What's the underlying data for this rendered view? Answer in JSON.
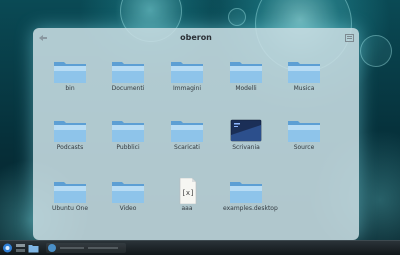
{
  "window": {
    "title": "oberon"
  },
  "items": [
    {
      "label": "bin",
      "icon": "folder-icon"
    },
    {
      "label": "Documenti",
      "icon": "folder-icon"
    },
    {
      "label": "Immagini",
      "icon": "folder-icon"
    },
    {
      "label": "Modelli",
      "icon": "folder-icon"
    },
    {
      "label": "Musica",
      "icon": "folder-icon"
    },
    {
      "label": "Podcasts",
      "icon": "folder-icon"
    },
    {
      "label": "Pubblici",
      "icon": "folder-icon"
    },
    {
      "label": "Scaricati",
      "icon": "folder-icon"
    },
    {
      "label": "Scrivania",
      "icon": "desktop-folder-icon"
    },
    {
      "label": "Source",
      "icon": "folder-icon"
    },
    {
      "label": "Ubuntu One",
      "icon": "folder-icon"
    },
    {
      "label": "Video",
      "icon": "folder-icon"
    },
    {
      "label": "aaa",
      "icon": "latex-file-icon",
      "file_glyph": "[x]"
    },
    {
      "label": "examples.desktop",
      "icon": "folder-icon"
    }
  ],
  "taskbar": {
    "icons": [
      "kde-menu-icon",
      "activity-icon",
      "folder-view-icon",
      "app-icon"
    ]
  },
  "colors": {
    "folder_light": "#bfe0f6",
    "folder_mid": "#8ec4ea",
    "folder_dark": "#5d9fd4",
    "window_bg": "#c8dee4",
    "accent_glow": "#8cf0ff"
  }
}
